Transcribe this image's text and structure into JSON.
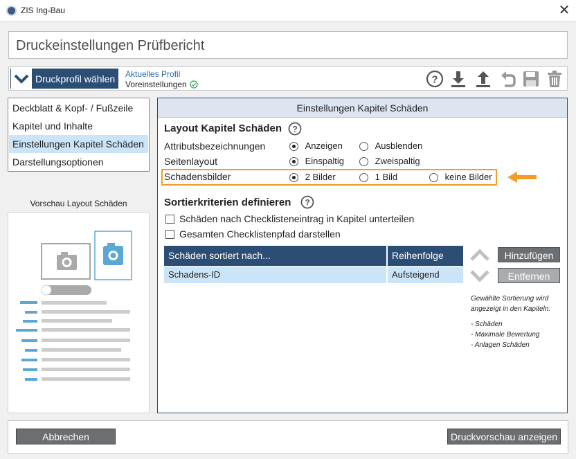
{
  "window": {
    "title": "ZIS Ing-Bau",
    "close_glyph": "✕"
  },
  "header": {
    "title": "Druckeinstellungen Prüfbericht"
  },
  "profile": {
    "button_label": "Druckprofil wählen",
    "caption": "Aktuelles Profil",
    "value": "Voreinstellungen",
    "toolbar_icons": [
      "help-icon",
      "download-icon",
      "upload-icon",
      "undo-icon",
      "save-icon",
      "delete-icon"
    ]
  },
  "nav": {
    "items": [
      {
        "label": "Deckblatt & Kopf- / Fußzeile"
      },
      {
        "label": "Kapitel und Inhalte"
      },
      {
        "label": "Einstellungen Kapitel Schäden"
      },
      {
        "label": "Darstellungsoptionen"
      }
    ],
    "active_index": 2
  },
  "preview": {
    "title": "Vorschau Layout Schäden"
  },
  "panel": {
    "title": "Einstellungen Kapitel Schäden",
    "layout_title": "Layout Kapitel Schäden",
    "rows": [
      {
        "label": "Attributsbezeichnungen",
        "options": [
          "Anzeigen",
          "Ausblenden"
        ],
        "selected": 0
      },
      {
        "label": "Seitenlayout",
        "options": [
          "Einspaltig",
          "Zweispaltig"
        ],
        "selected": 0
      },
      {
        "label": "Schadensbilder",
        "options": [
          "2 Bilder",
          "1 Bild",
          "keine Bilder"
        ],
        "selected": 0
      }
    ],
    "sort_title": "Sortierkriterien definieren",
    "checkboxes": [
      {
        "label": "Schäden nach Checklisteneintrag in Kapitel unterteilen",
        "checked": false
      },
      {
        "label": "Gesamten Checklistenpfad darstellen",
        "checked": false
      }
    ],
    "table": {
      "headers": [
        "Schäden sortiert nach...",
        "Reihenfolge"
      ],
      "rows": [
        [
          "Schadens-ID",
          "Aufsteigend"
        ]
      ]
    },
    "add_button": "Hinzufügen",
    "remove_button": "Entfernen",
    "note_lines": [
      "Gewählte Sortierung wird",
      "angezeigt in den Kapiteln:",
      "- Schäden",
      "- Maximale Bewertung",
      "- Anlagen Schäden"
    ]
  },
  "footer": {
    "cancel_label": "Abbrechen",
    "preview_label": "Druckvorschau anzeigen"
  },
  "colors": {
    "accent": "#2d4e74",
    "highlight": "#f39c28",
    "selection": "#cce4f7"
  }
}
